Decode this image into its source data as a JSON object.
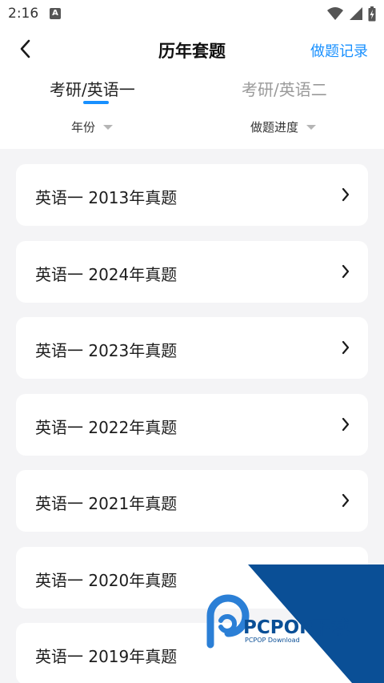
{
  "status_bar": {
    "time": "2:16",
    "app_badge": "A"
  },
  "nav": {
    "title": "历年套题",
    "action": "做题记录"
  },
  "tabs": [
    {
      "label": "考研/英语一",
      "active": true
    },
    {
      "label": "考研/英语二",
      "active": false
    }
  ],
  "filters": [
    {
      "label": "年份"
    },
    {
      "label": "做题进度"
    }
  ],
  "papers": [
    {
      "title": "英语一 2013年真题"
    },
    {
      "title": "英语一 2024年真题"
    },
    {
      "title": "英语一 2023年真题"
    },
    {
      "title": "英语一 2022年真题"
    },
    {
      "title": "英语一 2021年真题"
    },
    {
      "title": "英语一 2020年真题"
    },
    {
      "title": "英语一 2019年真题"
    }
  ],
  "watermark": {
    "brand": "PCPOP下载",
    "sub": "PCPOP Download"
  },
  "colors": {
    "accent": "#1890ff",
    "watermark": "#0a4f96"
  }
}
